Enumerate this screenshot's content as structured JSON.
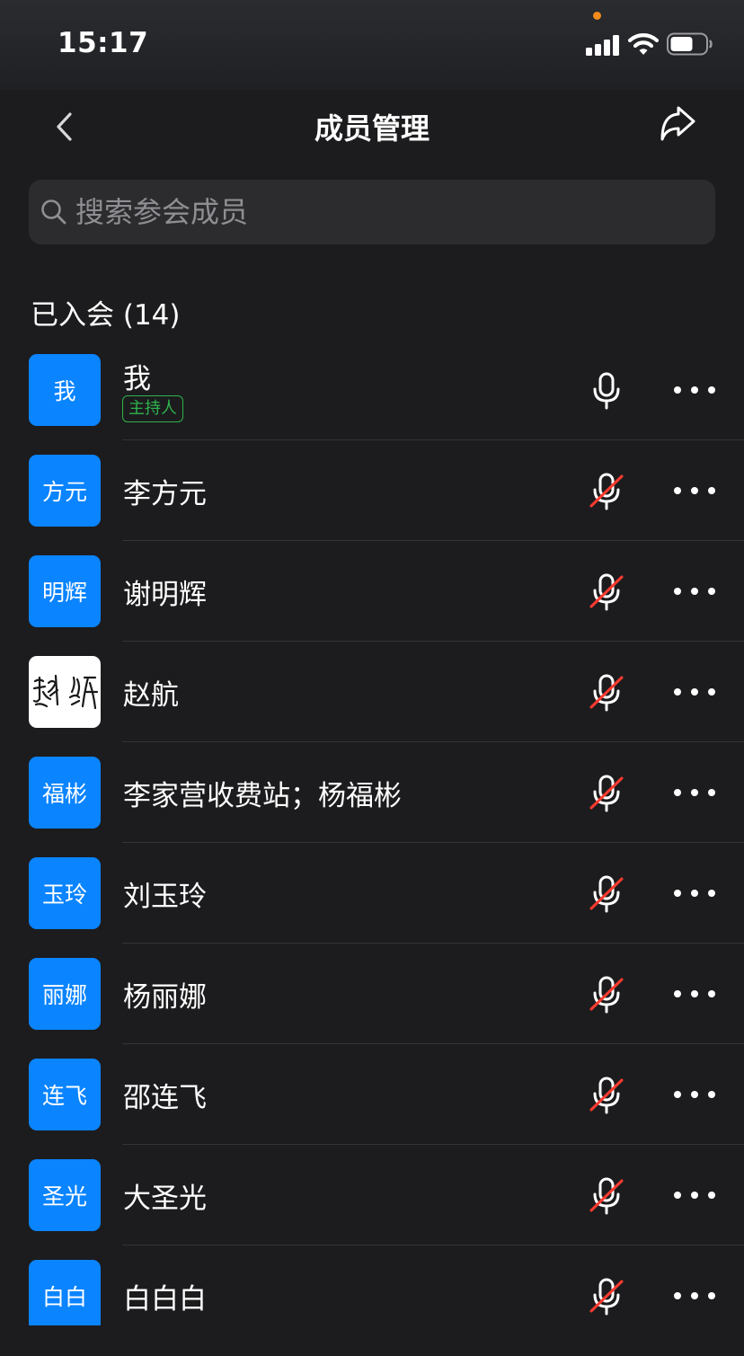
{
  "status_bar": {
    "time": "15:17",
    "indicator_color": "#f28b1c",
    "icons": [
      "signal-icon",
      "wifi-icon",
      "battery-icon"
    ]
  },
  "nav": {
    "title": "成员管理",
    "back_icon": "chevron-left-icon",
    "share_icon": "share-icon"
  },
  "search": {
    "placeholder": "搜索参会成员",
    "value": ""
  },
  "section": {
    "label": "已入会 (14)"
  },
  "colors": {
    "background": "#1c1c1e",
    "avatar_blue": "#0a84ff",
    "host_badge_green": "#2fb24c",
    "muted_slash_red": "#ff3b30"
  },
  "members": [
    {
      "avatar_text": "我",
      "name": "我",
      "badge": "主持人",
      "mic": "on"
    },
    {
      "avatar_text": "方元",
      "name": "李方元",
      "mic": "muted"
    },
    {
      "avatar_text": "明辉",
      "name": "谢明辉",
      "mic": "muted"
    },
    {
      "avatar_text": "赵航",
      "avatar_is_image": true,
      "name": "赵航",
      "mic": "muted"
    },
    {
      "avatar_text": "福彬",
      "name": "李家营收费站；杨福彬",
      "mic": "muted"
    },
    {
      "avatar_text": "玉玲",
      "name": "刘玉玲",
      "mic": "muted"
    },
    {
      "avatar_text": "丽娜",
      "name": "杨丽娜",
      "mic": "muted"
    },
    {
      "avatar_text": "连飞",
      "name": "邵连飞",
      "mic": "muted"
    },
    {
      "avatar_text": "圣光",
      "name": "大圣光",
      "mic": "muted"
    },
    {
      "avatar_text": "白白",
      "name": "白白白",
      "mic": "muted"
    }
  ]
}
